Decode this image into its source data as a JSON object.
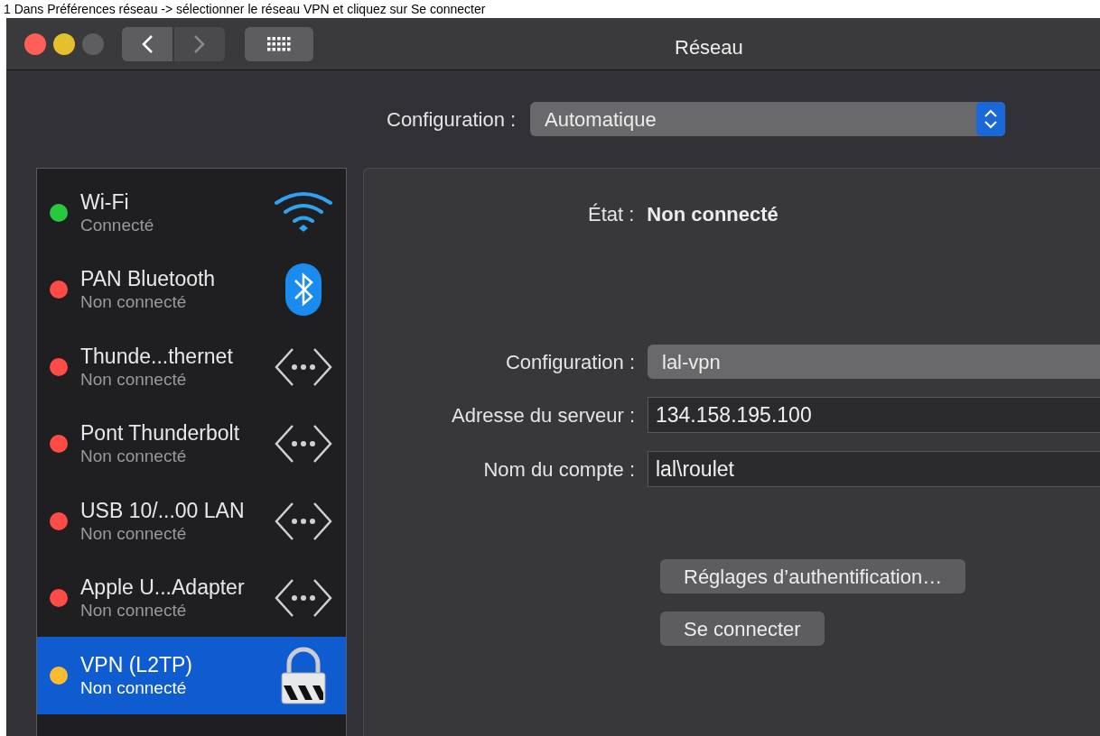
{
  "caption": "1 Dans Préférences réseau -> sélectionner le réseau VPN et cliquez sur Se connecter",
  "window": {
    "title": "Réseau"
  },
  "location": {
    "label": "Configuration :",
    "value": "Automatique"
  },
  "services": [
    {
      "name": "Wi-Fi",
      "status": "Connecté",
      "color": "#28c840",
      "kind": "wifi",
      "selected": false
    },
    {
      "name": "PAN Bluetooth",
      "status": "Non connecté",
      "color": "#ff4b46",
      "kind": "bluetooth",
      "selected": false
    },
    {
      "name": "Thunde...thernet",
      "status": "Non connecté",
      "color": "#ff4b46",
      "kind": "ethernet",
      "selected": false
    },
    {
      "name": "Pont Thunderbolt",
      "status": "Non connecté",
      "color": "#ff4b46",
      "kind": "ethernet",
      "selected": false
    },
    {
      "name": "USB 10/...00 LAN",
      "status": "Non connecté",
      "color": "#ff4b46",
      "kind": "ethernet",
      "selected": false
    },
    {
      "name": "Apple U...Adapter",
      "status": "Non connecté",
      "color": "#ff4b46",
      "kind": "ethernet",
      "selected": false
    },
    {
      "name": "VPN (L2TP)",
      "status": "Non connecté",
      "color": "#fdbb2e",
      "kind": "vpn",
      "selected": true
    }
  ],
  "detail": {
    "state_label": "État :",
    "state_value": "Non connecté",
    "fields": [
      {
        "label": "Configuration :",
        "value": "lal-vpn",
        "kind": "popup"
      },
      {
        "label": "Adresse du serveur :",
        "value": "134.158.195.100",
        "kind": "text"
      },
      {
        "label": "Nom du compte :",
        "value": "lal\\roulet",
        "kind": "text"
      }
    ],
    "buttons": [
      "Réglages d’authentification…",
      "Se connecter"
    ]
  }
}
